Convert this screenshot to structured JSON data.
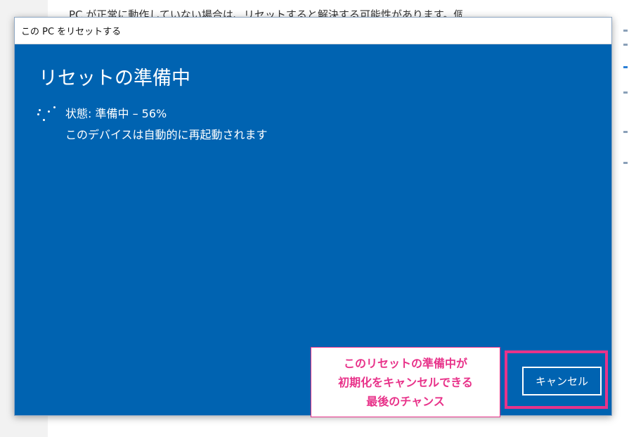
{
  "background": {
    "partial_text": "PC が正常に動作していない場合は、リセットすると解決する可能性があります。個"
  },
  "dialog": {
    "title": "この PC をリセットする",
    "heading": "リセットの準備中",
    "status_text": "状態: 準備中 – 56%",
    "progress_percent": 56,
    "restart_notice": "このデバイスは自動的に再起動されます",
    "cancel_label": "キャンセル",
    "background_color": "#0063b1"
  },
  "annotation": {
    "lines": [
      "このリセットの準備中が",
      "初期化をキャンセルできる",
      "最後のチャンス"
    ],
    "color": "#e8338a"
  },
  "icons": {
    "spinner": "loading-spinner-icon"
  }
}
